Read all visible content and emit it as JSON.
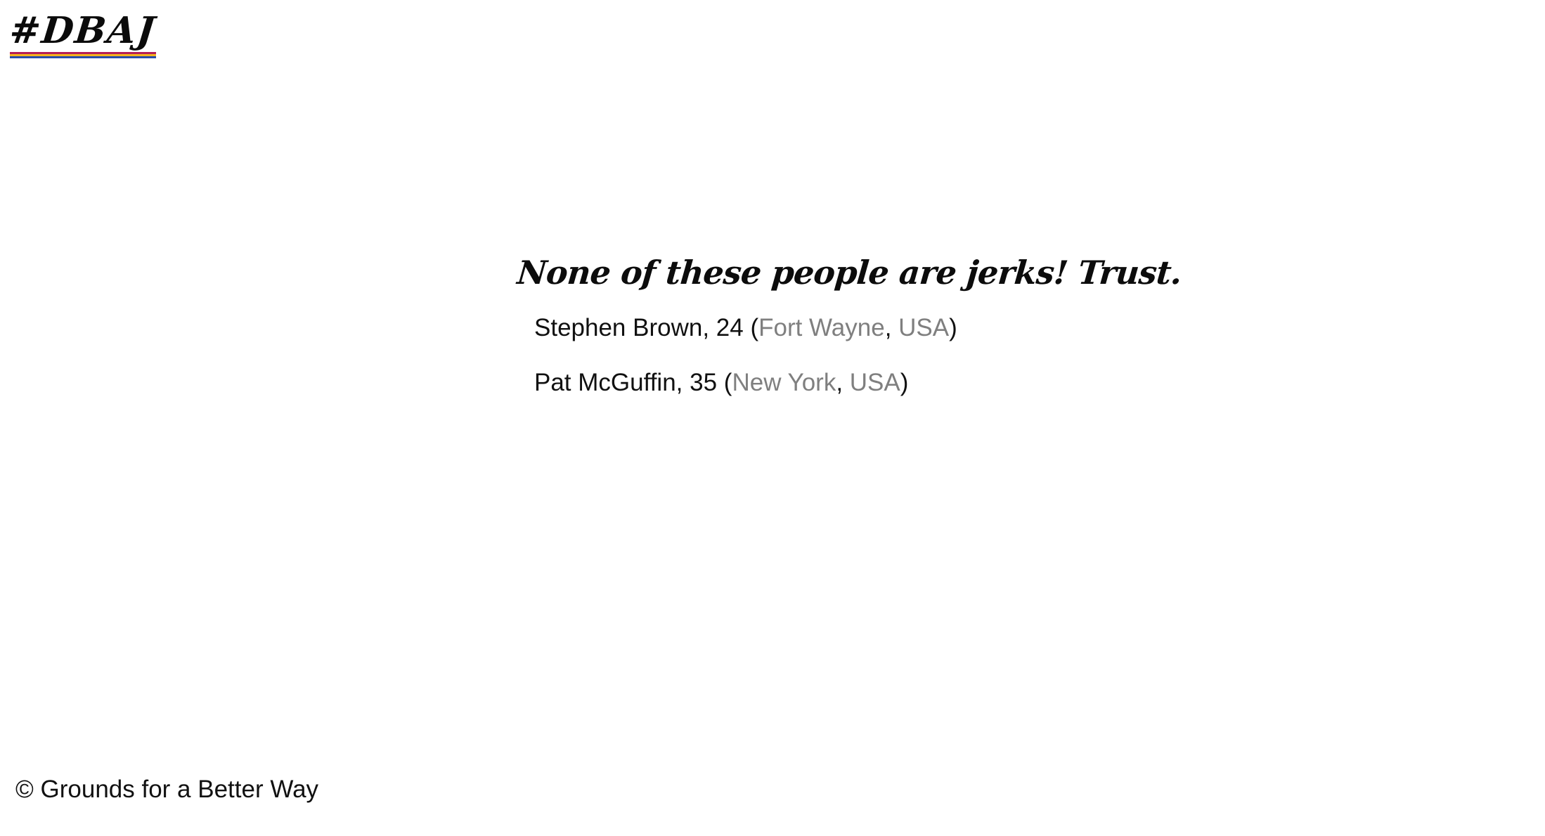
{
  "branding": {
    "logo_text": "#DBAJ",
    "stripe_colors": [
      "#b51f56",
      "#f3b21c",
      "#2a4ca8"
    ]
  },
  "main": {
    "headline": "None of these people are jerks! Trust.",
    "people": [
      {
        "name": "Stephen Brown",
        "age": "24",
        "city": "Fort Wayne",
        "country": "USA"
      },
      {
        "name": "Pat McGuffin",
        "age": "35",
        "city": "New York",
        "country": "USA"
      }
    ]
  },
  "footer": {
    "copyright": "© Grounds for a Better Way"
  }
}
